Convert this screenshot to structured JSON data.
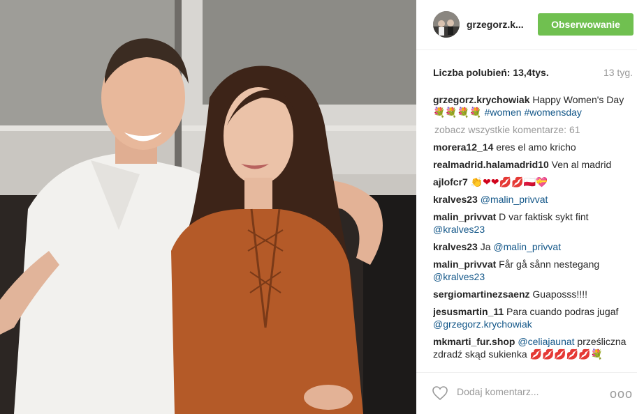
{
  "post": {
    "username": "grzegorz.k...",
    "follow_label": "Obserwowanie",
    "likes_label": "Liczba polubień: 13,4tys.",
    "time_ago": "13 tyg."
  },
  "caption": {
    "user": "grzegorz.krychowiak",
    "text": " Happy Women's Day ",
    "emojis": "💐💐💐💐",
    "tag1": "#women",
    "tag2": "#womensday"
  },
  "view_all": "zobacz wszystkie komentarze: 61",
  "comments": [
    {
      "user": "morera12_14",
      "text": " eres el amo kricho"
    },
    {
      "user": "realmadrid.halamadrid10",
      "text": " Ven al madrid"
    },
    {
      "user": "ajlofcr7",
      "text": " 👏❤❤💋💋🇵🇱💝"
    },
    {
      "user": "kralves23",
      "mention": "@malin_privvat"
    },
    {
      "user": "malin_privvat",
      "text": " D var faktisk sykt fint ",
      "mention": "@kralves23"
    },
    {
      "user": "kralves23",
      "text": " Ja ",
      "mention": "@malin_privvat"
    },
    {
      "user": "malin_privvat",
      "text": " Får gå sånn nestegang ",
      "mention": "@kralves23"
    },
    {
      "user": "sergiomartinezsaenz",
      "text": " Guaposss!!!!"
    },
    {
      "user": "jesusmartin_11",
      "text": " Para cuando podras jugaf ",
      "mention": "@grzegorz.krychowiak"
    },
    {
      "user": "mkmarti_fur.shop",
      "mention": "@celiajaunat",
      "text": " prześliczna zdradź skąd sukienka",
      "emojis": "💋💋💋💋💋💐"
    }
  ],
  "footer": {
    "placeholder": "Dodaj komentarz...",
    "more": "ooo"
  },
  "icons": {
    "like": "heart-outline-icon",
    "more": "more-options-icon"
  },
  "colors": {
    "follow": "#70c050",
    "link": "#125688",
    "muted": "#999999"
  }
}
